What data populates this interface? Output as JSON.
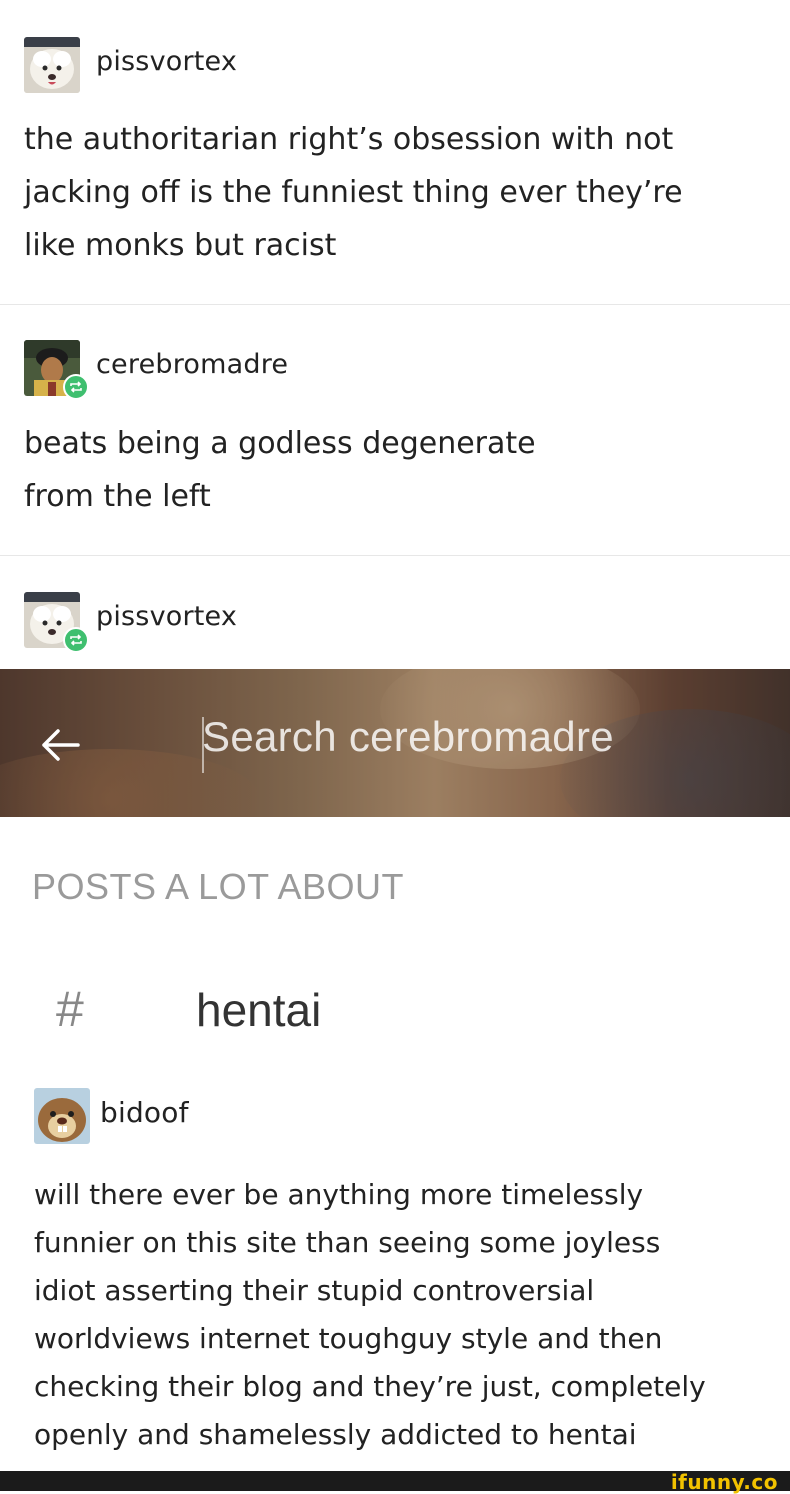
{
  "posts": [
    {
      "username": "pissvortex",
      "lines": [
        "the authoritarian right’s obsession with not",
        "jacking off is the funniest thing ever they’re",
        "like monks but racist"
      ]
    },
    {
      "username": "cerebromadre",
      "lines": [
        "beats being a godless degenerate",
        "from the left"
      ]
    },
    {
      "username": "pissvortex"
    }
  ],
  "search": {
    "back_icon": "arrow-left-icon",
    "placeholder": "Search cerebromadre"
  },
  "posts_a_lot_about": {
    "heading": "POSTS A LOT ABOUT",
    "hash_symbol": "#",
    "tag": "hentai"
  },
  "bottom_post": {
    "username": "bidoof",
    "lines": [
      "will there ever be anything more timelessly",
      "funnier on this site than seeing some joyless",
      "idiot asserting their stupid controversial",
      "worldviews internet toughguy style and then",
      "checking their blog and they’re just, completely",
      "openly and shamelessly addicted to hentai"
    ]
  },
  "watermark": "ifunny.co",
  "colors": {
    "reblog_badge": "#3fbf6f",
    "watermark": "#f2c200",
    "heading_gray": "#9a9a9a"
  }
}
